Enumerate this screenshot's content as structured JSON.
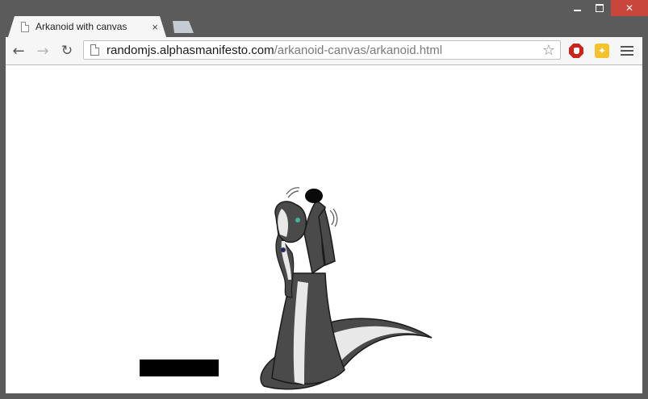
{
  "tab": {
    "title": "Arkanoid with canvas",
    "close_glyph": "×"
  },
  "toolbar": {
    "back_glyph": "←",
    "forward_glyph": "→",
    "reload_glyph": "↻",
    "url_host": "randomjs.alphasmanifesto.com",
    "url_path": "/arkanoid-canvas/arkanoid.html",
    "star_glyph": "☆",
    "extension_glyph": "✦"
  },
  "icons": {
    "minimize": "minimize-icon",
    "maximize": "maximize-icon",
    "close": "close-icon",
    "page": "page-icon",
    "adblock": "adblock-icon",
    "extension": "extension-icon",
    "menu": "hamburger-menu-icon"
  },
  "colors": {
    "window_frame": "#5b5b5b",
    "close_button": "#c9463d",
    "paddle": "#000000",
    "mascot_fur": "#4a4a4a",
    "mascot_stripe": "#e8e8e8"
  }
}
